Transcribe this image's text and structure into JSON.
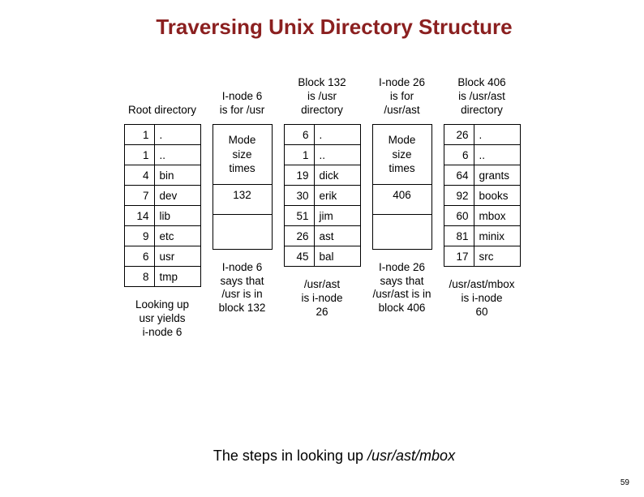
{
  "title": "Traversing Unix Directory Structure",
  "caption_prefix": "The steps in looking up ",
  "caption_path": "/usr/ast/mbox",
  "page_number": "59",
  "columns": [
    {
      "header": "Root directory",
      "type": "dir",
      "rows": [
        {
          "n": "1",
          "name": "."
        },
        {
          "n": "1",
          "name": ".."
        },
        {
          "n": "4",
          "name": "bin"
        },
        {
          "n": "7",
          "name": "dev"
        },
        {
          "n": "14",
          "name": "lib"
        },
        {
          "n": "9",
          "name": "etc"
        },
        {
          "n": "6",
          "name": "usr"
        },
        {
          "n": "8",
          "name": "tmp"
        }
      ],
      "footer": "Looking up\nusr yields\ni-node 6"
    },
    {
      "header": "I-node 6\nis for /usr",
      "type": "inode",
      "top": "Mode\nsize\ntimes",
      "mid": "132",
      "footer": "I-node 6\nsays that\n/usr is in\nblock 132"
    },
    {
      "header": "Block 132\nis /usr\ndirectory",
      "type": "dir",
      "rows": [
        {
          "n": "6",
          "name": "."
        },
        {
          "n": "1",
          "name": ".."
        },
        {
          "n": "19",
          "name": "dick"
        },
        {
          "n": "30",
          "name": "erik"
        },
        {
          "n": "51",
          "name": "jim"
        },
        {
          "n": "26",
          "name": "ast"
        },
        {
          "n": "45",
          "name": "bal"
        }
      ],
      "footer": "/usr/ast\nis i-node\n26"
    },
    {
      "header": "I-node 26\nis for\n/usr/ast",
      "type": "inode",
      "top": "Mode\nsize\ntimes",
      "mid": "406",
      "footer": "I-node 26\nsays that\n/usr/ast is in\nblock 406"
    },
    {
      "header": "Block 406\nis /usr/ast\ndirectory",
      "type": "dir",
      "rows": [
        {
          "n": "26",
          "name": "."
        },
        {
          "n": "6",
          "name": ".."
        },
        {
          "n": "64",
          "name": "grants"
        },
        {
          "n": "92",
          "name": "books"
        },
        {
          "n": "60",
          "name": "mbox"
        },
        {
          "n": "81",
          "name": "minix"
        },
        {
          "n": "17",
          "name": "src"
        }
      ],
      "footer": "/usr/ast/mbox\nis i-node\n60"
    }
  ]
}
